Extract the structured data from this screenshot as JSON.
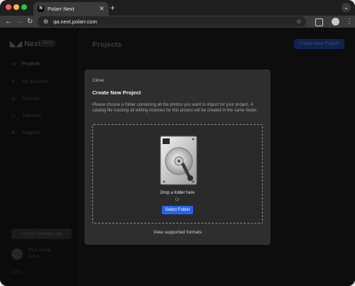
{
  "browser": {
    "tab_title": "Polarr Next",
    "tab_favicon_letter": "N",
    "new_tab_symbol": "+",
    "url": "qa.next.polarr.com"
  },
  "sidebar": {
    "logo": "Next",
    "badge": "Beta",
    "items": [
      {
        "label": "Projects",
        "icon": "layers-icon"
      },
      {
        "label": "My Brushes",
        "icon": "brush-icon"
      },
      {
        "label": "Colours",
        "icon": "palette-icon"
      },
      {
        "label": "Tutorials",
        "icon": "book-icon"
      },
      {
        "label": "Support",
        "icon": "help-icon"
      }
    ],
    "install_label": "Install Desktop App",
    "user_name": "Rick Wang",
    "user_sub": "Editor",
    "version": "0.8.5"
  },
  "main": {
    "title": "Projects",
    "create_button": "Create New Project"
  },
  "modal": {
    "close_label": "Close",
    "title": "Create New Project",
    "description": "Please choose a folder containing all the photos you want to import for your project. A catalog file tracking all editing histories for this project will be created in the same folder.",
    "drop_text": "Drop a folder here",
    "or_text": "Or",
    "select_button": "Select Folder",
    "formats_link": "View supported formats"
  },
  "colors": {
    "accent": "#2563eb",
    "modal_bg": "#2e2e2e",
    "app_bg": "#0d0d0d"
  }
}
